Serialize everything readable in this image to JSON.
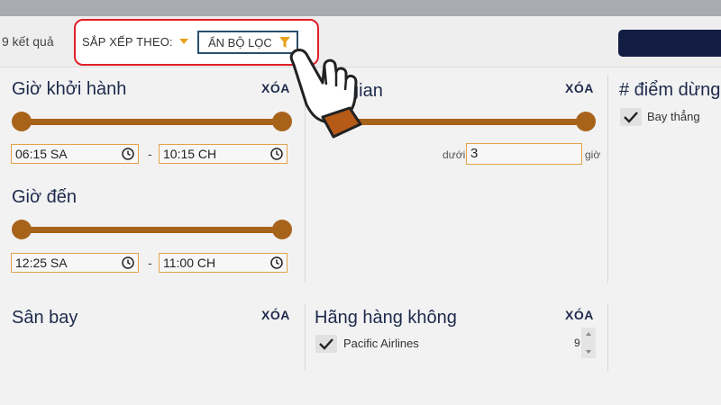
{
  "results": {
    "count_text": "9 kết quả"
  },
  "sort": {
    "label": "SẮP XẾP THEO:",
    "hide_filters_label": "ẨN BỘ LỌC"
  },
  "departure": {
    "title": "Giờ khởi hành",
    "clear": "XÓA",
    "from": "06:15 SA",
    "to": "10:15 CH",
    "dash": "-"
  },
  "arrival": {
    "title": "Giờ đến",
    "from": "12:25 SA",
    "to": "11:00 CH",
    "dash": "-"
  },
  "duration": {
    "title_visible": "i gian",
    "clear": "XÓA",
    "under_label": "dưới",
    "value": "3",
    "unit": "giờ"
  },
  "stops": {
    "title": "# điểm dừng",
    "option": "Bay thẳng"
  },
  "airport": {
    "title": "Sân bay",
    "clear": "XÓA"
  },
  "airline": {
    "title": "Hãng hàng không",
    "clear": "XÓA",
    "option": "Pacific Airlines",
    "count": "9"
  },
  "colors": {
    "accent": "#a8631b",
    "highlight": "#e0202a",
    "navy": "#131d44",
    "filter_icon": "#e8a21a"
  },
  "icons": [
    "clock-icon",
    "funnel-icon",
    "checkmark-icon",
    "pointing-hand-icon",
    "dropdown-caret-icon",
    "spinner-arrow-icon"
  ]
}
